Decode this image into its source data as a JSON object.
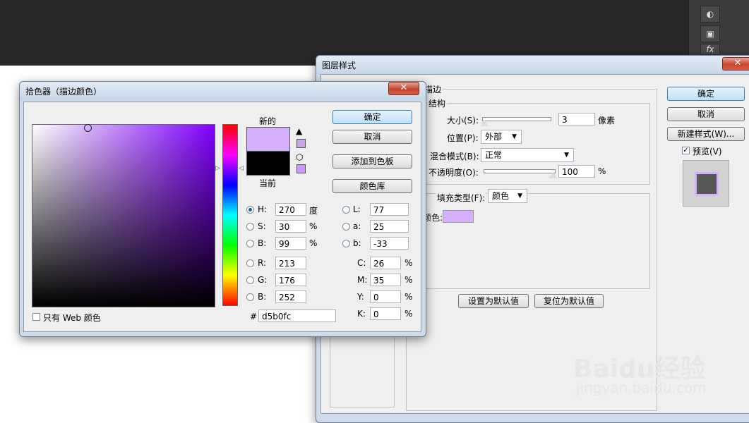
{
  "workspace": {
    "tools": [
      "◐",
      "▣",
      "fx"
    ]
  },
  "layer_style": {
    "title": "图层样式",
    "close": "✕",
    "section": "描边",
    "structure": "结构",
    "size_label": "大小(S):",
    "size_value": "3",
    "size_unit": "像素",
    "position_label": "位置(P):",
    "position_value": "外部",
    "blend_label": "混合模式(B):",
    "blend_value": "正常",
    "opacity_label": "不透明度(O):",
    "opacity_value": "100",
    "opacity_unit": "%",
    "fill_type_label": "填充类型(F):",
    "fill_type_value": "颜色",
    "color_label": "颜色:",
    "swatch_color": "#d5b0fc",
    "set_default": "设置为默认值",
    "reset_default": "复位为默认值",
    "ok": "确定",
    "cancel": "取消",
    "new_style": "新建样式(W)...",
    "preview_label": "预览(V)",
    "preview_checked": "✓"
  },
  "picker": {
    "title": "拾色器（描边颜色）",
    "close": "✕",
    "new_label": "新的",
    "current_label": "当前",
    "new_color": "#d5b0fc",
    "current_color": "#000000",
    "ok": "确定",
    "cancel": "取消",
    "add_swatch": "添加到色板",
    "color_lib": "颜色库",
    "hsb": [
      {
        "label": "H:",
        "value": "270",
        "unit": "度",
        "selected": true
      },
      {
        "label": "S:",
        "value": "30",
        "unit": "%",
        "selected": false
      },
      {
        "label": "B:",
        "value": "99",
        "unit": "%",
        "selected": false
      }
    ],
    "rgb": [
      {
        "label": "R:",
        "value": "213"
      },
      {
        "label": "G:",
        "value": "176"
      },
      {
        "label": "B:",
        "value": "252"
      }
    ],
    "lab": [
      {
        "label": "L:",
        "value": "77"
      },
      {
        "label": "a:",
        "value": "25"
      },
      {
        "label": "b:",
        "value": "-33"
      }
    ],
    "cmyk": [
      {
        "label": "C:",
        "value": "26",
        "unit": "%"
      },
      {
        "label": "M:",
        "value": "35",
        "unit": "%"
      },
      {
        "label": "Y:",
        "value": "0",
        "unit": "%"
      },
      {
        "label": "K:",
        "value": "0",
        "unit": "%"
      }
    ],
    "hex_label": "#",
    "hex_value": "d5b0fc",
    "web_only": "只有 Web 颜色"
  },
  "watermark": {
    "brand": "Baidu经验",
    "url": "jingyan.baidu.com"
  }
}
